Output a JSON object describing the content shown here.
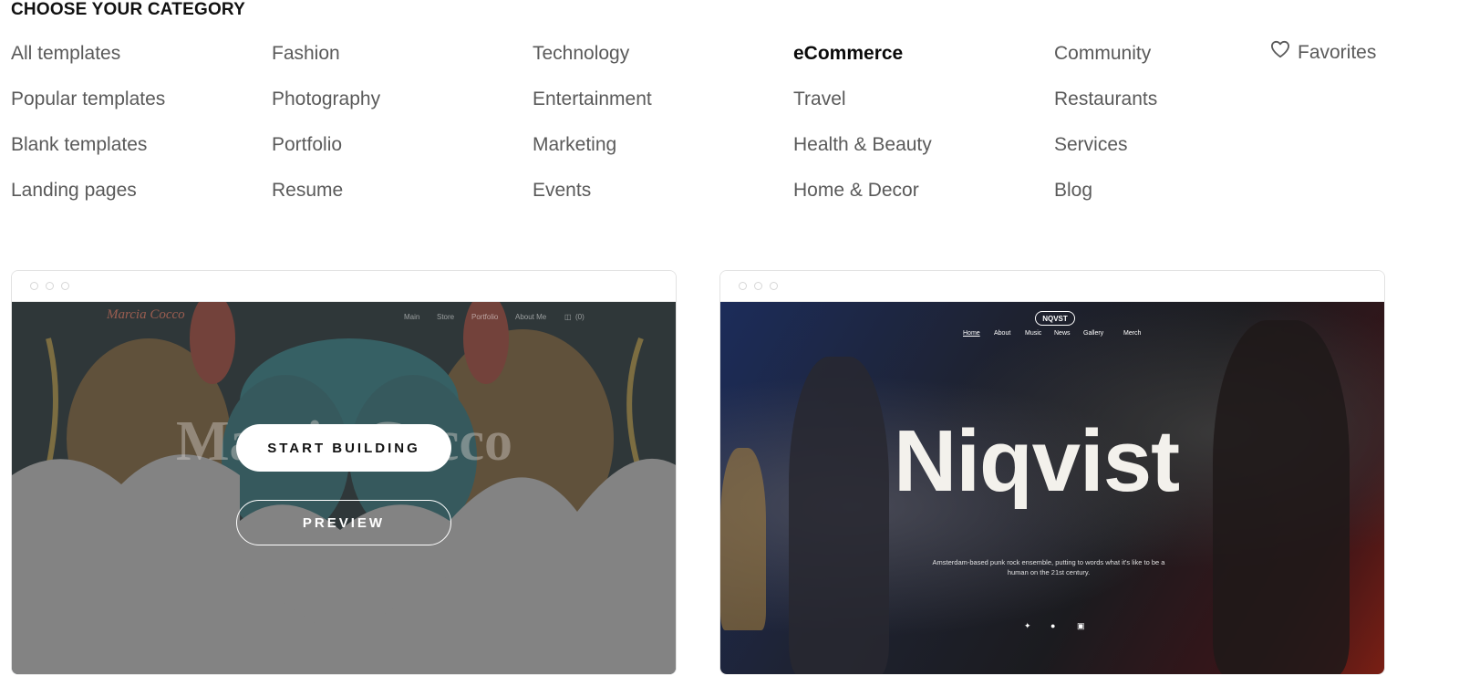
{
  "heading": "CHOOSE YOUR CATEGORY",
  "categories": [
    [
      "All templates",
      "Popular templates",
      "Blank templates",
      "Landing pages"
    ],
    [
      "Fashion",
      "Photography",
      "Portfolio",
      "Resume"
    ],
    [
      "Technology",
      "Entertainment",
      "Marketing",
      "Events"
    ],
    [
      "eCommerce",
      "Travel",
      "Health & Beauty",
      "Home & Decor"
    ],
    [
      "Community",
      "Restaurants",
      "Services",
      "Blog"
    ]
  ],
  "active_category": "eCommerce",
  "favorites": {
    "label": "Favorites",
    "icon": "heart-icon"
  },
  "cards": [
    {
      "site_title": "Marcia Cocco",
      "site_logo": "Marcia Cocco",
      "nav": [
        "Main",
        "Store",
        "Portfolio",
        "About Me"
      ],
      "cart": "(0)",
      "start_label": "START BUILDING",
      "preview_label": "PREVIEW"
    },
    {
      "logo": "NQVST",
      "nav": [
        "Home",
        "About",
        "Music",
        "News",
        "Gallery",
        "Merch"
      ],
      "title": "Niqvist",
      "description": "Amsterdam-based punk rock ensemble, putting to words what it's like to be a human on the 21st century.",
      "social_icons": [
        "twitter-icon",
        "facebook-icon",
        "instagram-icon"
      ]
    }
  ],
  "colors": {
    "active": "#0a0a0a",
    "inactive": "#5a5a5a",
    "border": "#e2e2e2"
  }
}
